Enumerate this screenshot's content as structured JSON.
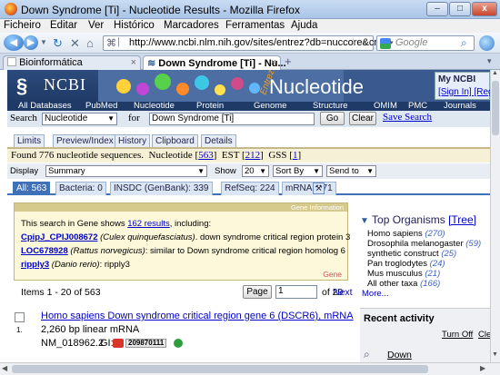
{
  "window": {
    "title": "Down Syndrome [Ti] - Nucleotide Results - Mozilla Firefox",
    "min": "–",
    "max": "□",
    "close": "x"
  },
  "menubar": {
    "items": [
      "Ficheiro",
      "Editar",
      "Ver",
      "Histórico",
      "Marcadores",
      "Ferramentas",
      "Ajuda"
    ]
  },
  "nav": {
    "url": "http://www.ncbi.nlm.nih.gov/sites/entrez?db=nuccore&cmd=",
    "search_placeholder": "Google"
  },
  "tabs": [
    {
      "label": "Bioinformática",
      "active": false
    },
    {
      "label": "Down Syndrome [Ti] - Nu...",
      "active": true
    }
  ],
  "ncbi": {
    "logo": "NCBI",
    "db_title": "Nucleotide",
    "entrez": "Entrez",
    "my_ncbi": "My NCBI",
    "sign_in": "[Sign In] [Regist",
    "dbnav": [
      "All Databases",
      "PubMed",
      "Nucleotide",
      "Protein",
      "Genome",
      "Structure",
      "OMIM",
      "PMC",
      "Journals"
    ]
  },
  "search": {
    "label": "Search",
    "db": "Nucleotide",
    "for_label": "for",
    "query": "Down Syndrome [Ti]",
    "go": "Go",
    "clear": "Clear",
    "save": "Save Search"
  },
  "subtabs": [
    "Limits",
    "Preview/Index",
    "History",
    "Clipboard",
    "Details"
  ],
  "found": {
    "text": "Found 776 nucleotide sequences.",
    "nucleotide_label": "Nucleotide",
    "nucleotide_count": "563",
    "est_label": "EST",
    "est_count": "212",
    "gss_label": "GSS",
    "gss_count": "1"
  },
  "display": {
    "display_label": "Display",
    "display_value": "Summary",
    "show_label": "Show",
    "show_value": "20",
    "sort_value": "Sort By",
    "send_value": "Send to"
  },
  "filter_tabs": [
    {
      "label": "All: 563",
      "active": true
    },
    {
      "label": "Bacteria: 0",
      "active": false
    },
    {
      "label": "INSDC (GenBank): 339",
      "active": false
    },
    {
      "label": "RefSeq: 224",
      "active": false
    },
    {
      "label": "mRNA: 371",
      "active": false
    }
  ],
  "gene_info": {
    "header": "Gene Information",
    "intro_pre": "This search in Gene shows",
    "intro_link": "162 results",
    "intro_post": ", including:",
    "entries": [
      {
        "id": "CpipJ_CPIJ008672",
        "species": "(Culex quinquefasciatus)",
        "desc": ". down syndrome critical region protein 3"
      },
      {
        "id": "LOC678928",
        "species": "(Rattus norvegicus)",
        "desc": ": similar to Down syndrome critical region homolog 6"
      },
      {
        "id": "ripply3",
        "species": "(Danio rerio)",
        "desc": ": ripply3"
      }
    ],
    "gene_label": "Gene"
  },
  "top_organisms": {
    "title": "Top Organisms",
    "tree": "[Tree]",
    "items": [
      {
        "name": "Homo sapiens",
        "count": "(270)"
      },
      {
        "name": "Drosophila melanogaster",
        "count": "(59)"
      },
      {
        "name": "synthetic construct",
        "count": "(25)"
      },
      {
        "name": "Pan troglodytes",
        "count": "(24)"
      },
      {
        "name": "Mus musculus",
        "count": "(21)"
      },
      {
        "name": "All other taxa",
        "count": "(166)"
      }
    ],
    "more": "More..."
  },
  "pager": {
    "items_text": "Items 1 - 20 of 563",
    "page_btn": "Page",
    "page_value": "1",
    "of_text": "of 29",
    "next": "Next"
  },
  "result": {
    "number": "1.",
    "title": "Homo sapiens Down syndrome critical region gene 6 (DSCR6), mRNA",
    "meta": "2,260 bp linear mRNA",
    "accession": "NM_018962.2",
    "gi_label": "GI:",
    "gi_value": "209870111"
  },
  "recent": {
    "title": "Recent activity",
    "turnoff": "Turn Off",
    "clear": "Clea",
    "item": "Down"
  }
}
